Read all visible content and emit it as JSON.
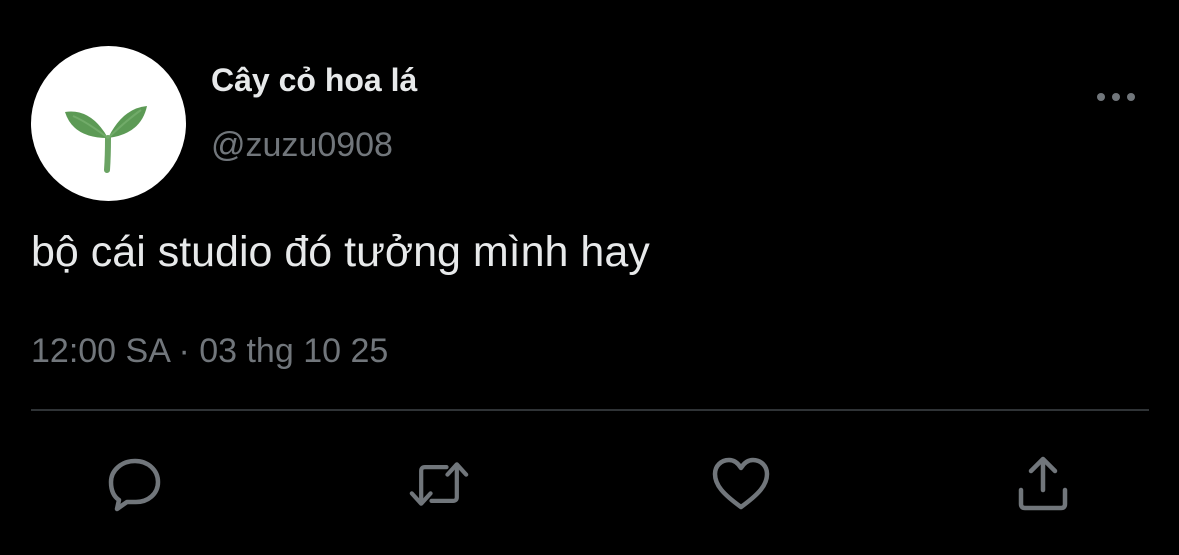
{
  "author": {
    "display_name": "Cây cỏ hoa lá",
    "handle": "@zuzu0908",
    "avatar_icon": "sprout-icon"
  },
  "tweet": {
    "text": "bộ cái studio đó tưởng mình hay",
    "timestamp": "12:00 SA · 03 thg 10 25"
  },
  "actions": {
    "reply_icon": "reply-icon",
    "retweet_icon": "retweet-icon",
    "like_icon": "heart-icon",
    "share_icon": "share-icon",
    "more_icon": "more-horizontal-icon"
  },
  "colors": {
    "background": "#000000",
    "primary_text": "#e7e9ea",
    "secondary_text": "#71767b",
    "icon": "#71767b",
    "divider": "#2f3336",
    "leaf_green": "#5c9a55"
  }
}
